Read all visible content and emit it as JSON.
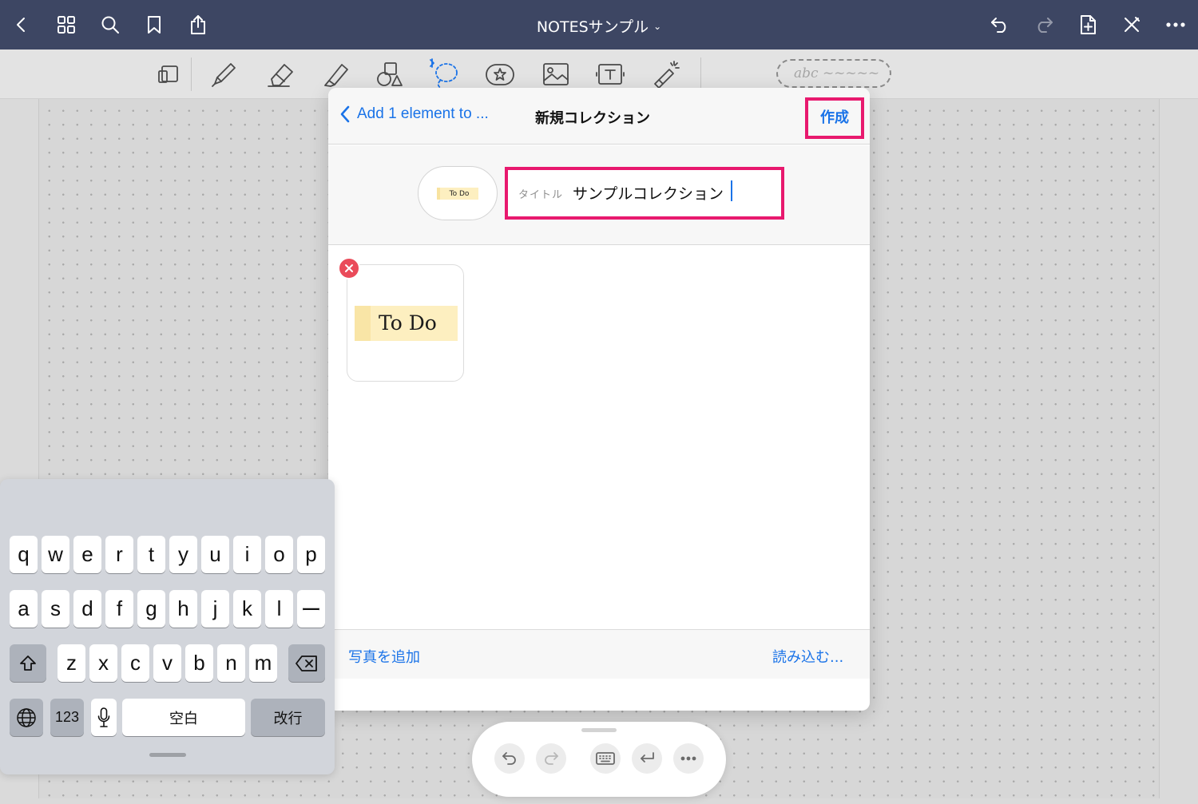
{
  "topbar": {
    "title": "NOTESサンプル",
    "title_chevron": "⌄",
    "icons": [
      "back-icon",
      "grid-icon",
      "search-icon",
      "bookmark-icon",
      "share-icon",
      "undo-icon",
      "redo-icon",
      "add-page-icon",
      "close-toolbar-icon",
      "more-icon"
    ]
  },
  "toolbar": {
    "tools": [
      "layout-icon",
      "pen-icon",
      "eraser-icon",
      "highlighter-icon",
      "shapes-icon",
      "lasso-icon",
      "sticker-icon",
      "image-icon",
      "text-icon",
      "laser-pointer-icon"
    ],
    "pill_text": "abc ~~~~~"
  },
  "popover": {
    "back_label": "Add 1 element to ...",
    "title": "新規コレクション",
    "create_label": "作成",
    "thumb_text": "To Do",
    "title_field_label": "タイトル",
    "title_field_value": "サンプルコレクション",
    "element_text": "To Do",
    "add_photo_label": "写真を追加",
    "import_label": "読み込む..."
  },
  "keyboard": {
    "row1": [
      "q",
      "w",
      "e",
      "r",
      "t",
      "y",
      "u",
      "i",
      "o",
      "p"
    ],
    "row2": [
      "a",
      "s",
      "d",
      "f",
      "g",
      "h",
      "j",
      "k",
      "l",
      "ー"
    ],
    "row3": [
      "z",
      "x",
      "c",
      "v",
      "b",
      "n",
      "m"
    ],
    "numbers_label": "123",
    "space_label": "空白",
    "return_label": "改行"
  },
  "colors": {
    "topbar_bg": "#3d4663",
    "accent_blue": "#1a73e8",
    "highlight_pink": "#e8196e",
    "remove_red": "#ea4b5a"
  }
}
